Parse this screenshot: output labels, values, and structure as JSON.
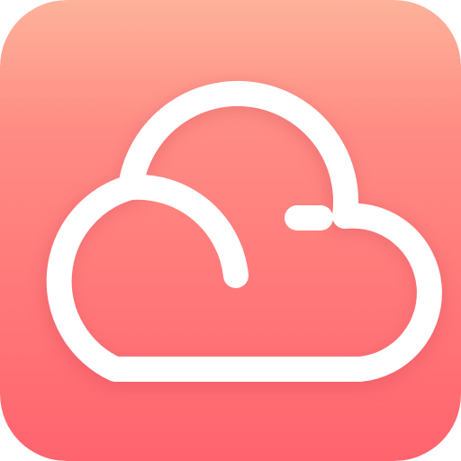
{
  "icon": {
    "name": "cloud-icon",
    "colors": {
      "gradient_top": "#FDB29A",
      "gradient_upper": "#FF8C84",
      "gradient_bottom": "#FF646E",
      "glyph": "#FFFFFF",
      "glyph_shadow": "#D84A58"
    }
  }
}
